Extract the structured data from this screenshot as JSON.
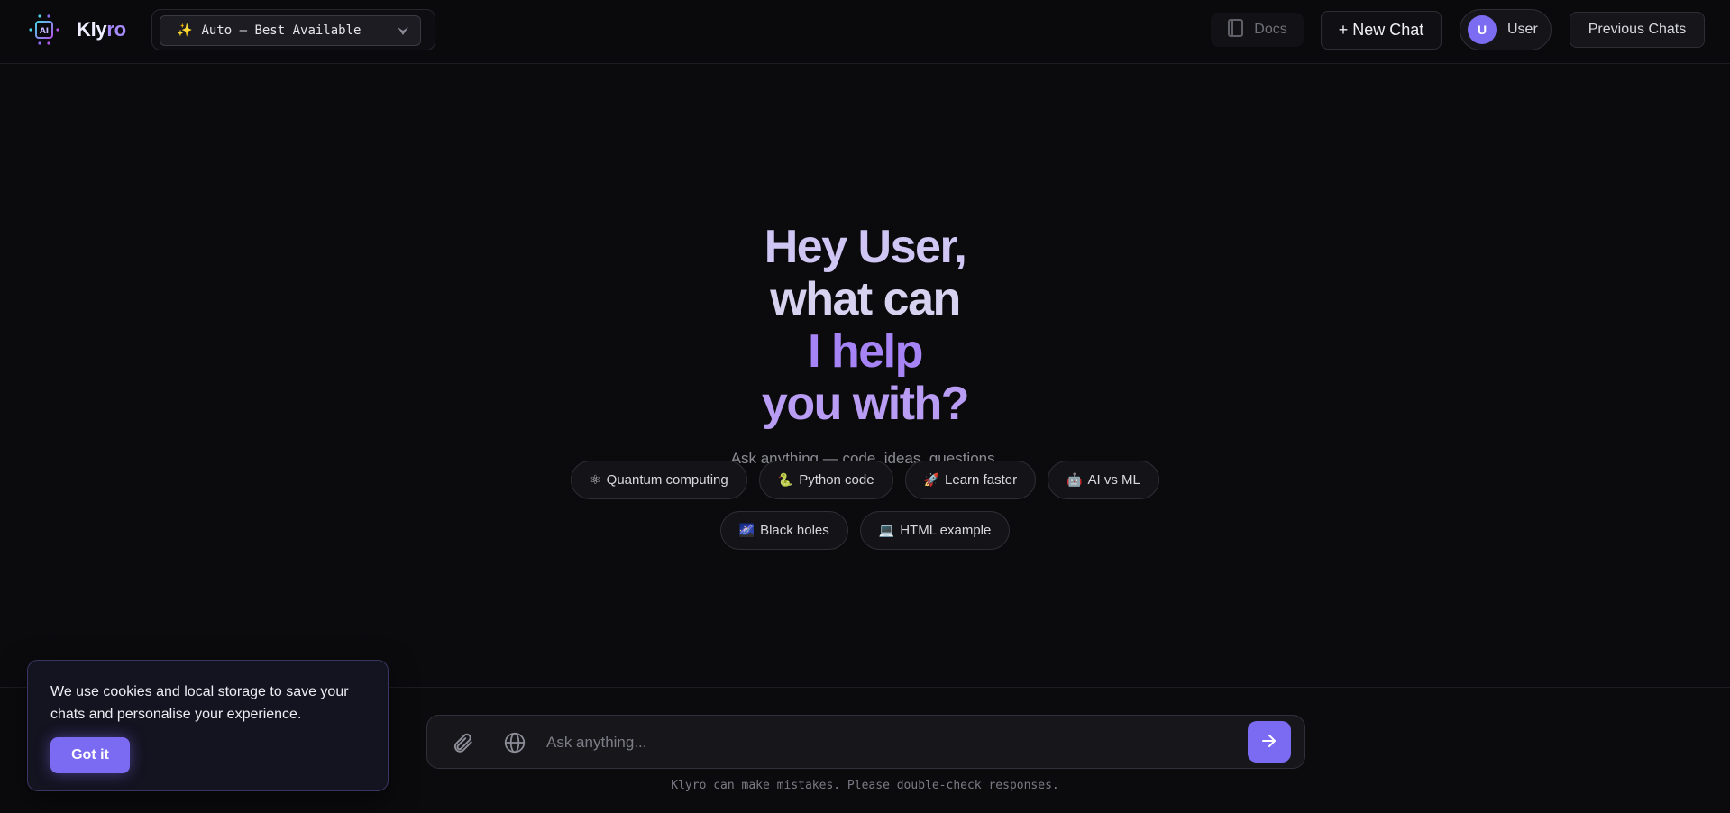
{
  "header": {
    "logo_text_a": "Kly",
    "logo_text_b": "ro",
    "model_select": {
      "icon": "sparkle-icon",
      "value": "Auto — Best Available"
    },
    "docs_label": "Docs",
    "new_chat_label": "+ New Chat",
    "user": {
      "avatar_initial": "U",
      "name": "User"
    },
    "previous_chats_label": "Previous Chats"
  },
  "hero": {
    "line1": "Hey User,",
    "line2a": "what can ",
    "line2b": "I help",
    "line3": "you with?",
    "subtitle": "Ask anything — code, ideas, questions."
  },
  "suggestions": {
    "row1": [
      {
        "icon": "⚛",
        "label": "Quantum computing"
      },
      {
        "icon": "🐍",
        "label": "Python code"
      },
      {
        "icon": "🚀",
        "label": "Learn faster"
      },
      {
        "icon": "🤖",
        "label": "AI vs ML"
      }
    ],
    "row2": [
      {
        "icon": "🌌",
        "label": "Black holes"
      },
      {
        "icon": "💻",
        "label": "HTML example"
      }
    ]
  },
  "composer": {
    "placeholder": "Ask anything...",
    "value": "",
    "disclaimer": "Klyro can make mistakes. Please double-check responses."
  },
  "cookie_banner": {
    "message": "We use cookies and local storage to save your chats and personalise your experience.",
    "button_label": "Got it"
  },
  "colors": {
    "background": "#0b0b0e",
    "accent": "#7b6af2",
    "heading_light": "#cfc6f3",
    "heading_purple": "#a784f5"
  }
}
